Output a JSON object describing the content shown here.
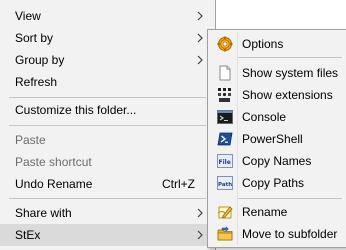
{
  "main_menu": {
    "view": "View",
    "sort_by": "Sort by",
    "group_by": "Group by",
    "refresh": "Refresh",
    "customize": "Customize this folder...",
    "paste": "Paste",
    "paste_shortcut": "Paste shortcut",
    "undo_rename": "Undo Rename",
    "undo_rename_shortcut": "Ctrl+Z",
    "share_with": "Share with",
    "stex": "StEx"
  },
  "submenu": {
    "options": "Options",
    "show_system_files": "Show system files",
    "show_extensions": "Show extensions",
    "console": "Console",
    "powershell": "PowerShell",
    "copy_names": "Copy Names",
    "copy_paths": "Copy Paths",
    "rename": "Rename",
    "move_to_subfolder": "Move to subfolder"
  },
  "colors": {
    "menu_bg": "#f2f2f2",
    "highlight_bg": "#dadada",
    "disabled_text": "#6d6d6d",
    "separator": "#c6c6c6"
  },
  "icons": {
    "options": "gear-icon",
    "show_system_files": "document-icon",
    "show_extensions": "extensions-icon",
    "console": "console-icon",
    "powershell": "powershell-icon",
    "copy_names": "copy-names-icon",
    "copy_paths": "copy-paths-icon",
    "rename": "rename-icon",
    "move_to_subfolder": "folder-icon"
  }
}
